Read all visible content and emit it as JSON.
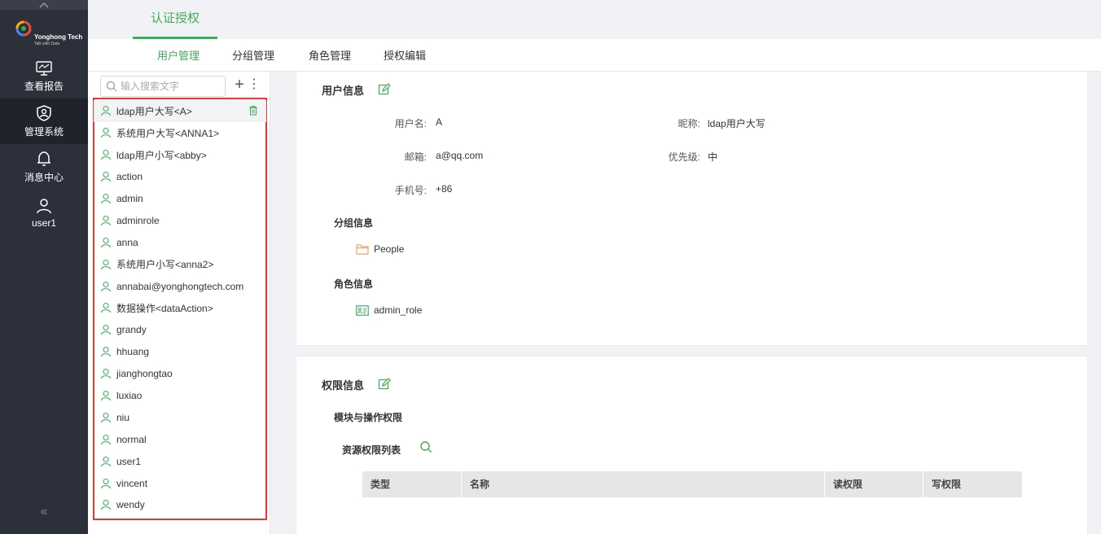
{
  "nav": {
    "logo_title": "Yonghong Tech",
    "logo_sub": "Talk with Data",
    "items": [
      {
        "label": "查看报告",
        "icon": "monitor-icon"
      },
      {
        "label": "管理系统",
        "icon": "shield-user-icon",
        "active": true
      },
      {
        "label": "消息中心",
        "icon": "bell-icon"
      },
      {
        "label": "user1",
        "icon": "user-icon"
      }
    ],
    "collapse": "«"
  },
  "top_tab": "认证授权",
  "sub_tabs": [
    "用户管理",
    "分组管理",
    "角色管理",
    "授权编辑"
  ],
  "list": {
    "search_placeholder": "输入搜索文字",
    "plus": "+",
    "more": "⋮",
    "users": [
      "ldap用户大写<A>",
      "系统用户大写<ANNA1>",
      "ldap用户小写<abby>",
      "action",
      "admin",
      "adminrole",
      "anna",
      "系统用户小写<anna2>",
      "annabai@yonghongtech.com",
      "数据操作<dataAction>",
      "grandy",
      "hhuang",
      "jianghongtao",
      "luxiao",
      "niu",
      "normal",
      "user1",
      "vincent",
      "wendy"
    ]
  },
  "user_info": {
    "title": "用户信息",
    "username_label": "用户名:",
    "username": "A",
    "nickname_label": "昵称:",
    "nickname": "ldap用户大写",
    "email_label": "邮箱:",
    "email": "a@qq.com",
    "priority_label": "优先级:",
    "priority": "中",
    "phone_label": "手机号:",
    "phone": "+86",
    "group_title": "分组信息",
    "group": "People",
    "role_title": "角色信息",
    "role": "admin_role"
  },
  "perm_info": {
    "title": "权限信息",
    "module_title": "模块与操作权限",
    "resource_title": "资源权限列表",
    "columns": [
      "类型",
      "名称",
      "读权限",
      "写权限"
    ]
  },
  "colors": {
    "accent": "#3fae5a",
    "nav_bg": "#2b303b",
    "highlight": "#e53935",
    "folder": "#f0a35e"
  }
}
